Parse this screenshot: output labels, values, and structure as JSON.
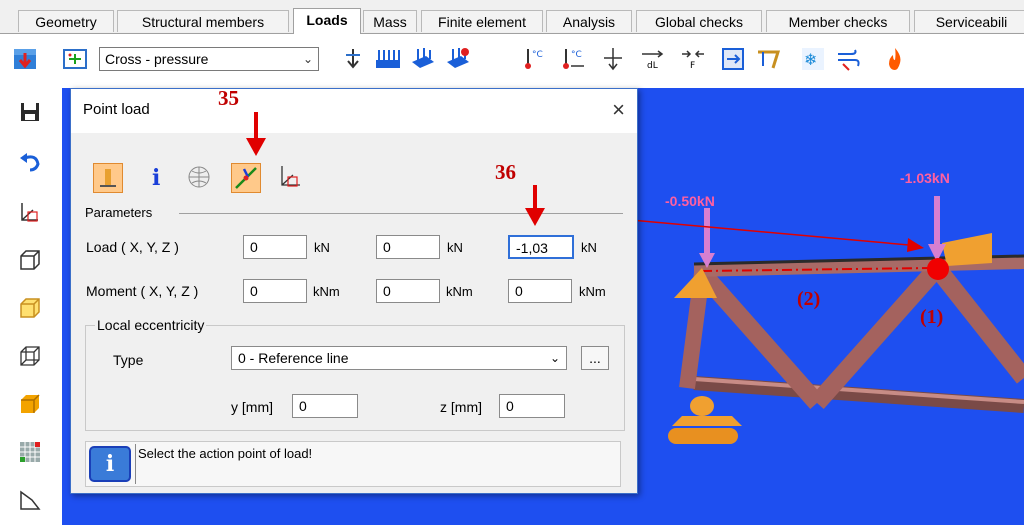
{
  "tabs": [
    {
      "label": "Geometry",
      "active": false
    },
    {
      "label": "Structural members",
      "active": false
    },
    {
      "label": "Loads",
      "active": true
    },
    {
      "label": "Mass",
      "active": false
    },
    {
      "label": "Finite element",
      "active": false
    },
    {
      "label": "Analysis",
      "active": false
    },
    {
      "label": "Global checks",
      "active": false
    },
    {
      "label": "Member checks",
      "active": false
    },
    {
      "label": "Serviceabili",
      "active": false
    }
  ],
  "toolbar": {
    "load_case": "Cross - pressure",
    "icons": [
      "load-case-icon",
      "new-load-icon",
      "dropdown-chevron-icon",
      "point-load-icon",
      "line-load-icon",
      "area-load-icon",
      "surface-load-icon",
      "temperature-icon",
      "temperature-gradient-icon",
      "load-distribution-icon",
      "displacement-load-icon",
      "force-load-icon",
      "load-transfer-icon",
      "crane-load-icon",
      "snow-load-icon",
      "wind-load-icon",
      "fire-icon"
    ]
  },
  "left_toolbar": [
    "save-icon",
    "undo-icon",
    "coordinate-system-icon",
    "view-wireframe-icon",
    "view-solid-icon",
    "view-outline-icon",
    "view-shaded-icon",
    "grid-icon",
    "polygon-icon"
  ],
  "dialog": {
    "title": "Point load",
    "close": "×",
    "section_parameters": "Parameters",
    "load_label": "Load ( X, Y, Z )",
    "load_x": "0",
    "load_y": "0",
    "load_z": "-1,03",
    "load_unit": "kN",
    "moment_label": "Moment ( X, Y, Z )",
    "moment_x": "0",
    "moment_y": "0",
    "moment_z": "0",
    "moment_unit": "kNm",
    "section_eccentricity": "Local eccentricity",
    "type_label": "Type",
    "type_value": "0 - Reference line",
    "more_button": "...",
    "y_label": "y [mm]",
    "y_value": "0",
    "z_label": "z [mm]",
    "z_value": "0",
    "info_message": "Select the action point of load!"
  },
  "annotations": {
    "step_35": "35",
    "step_36": "36",
    "node_1": "(1)",
    "member_2": "(2)"
  },
  "model": {
    "load_left": "-0.50kN",
    "load_right": "-1.03kN"
  },
  "colors": {
    "viewport_bg": "#1e4ff0",
    "annotation_red": "#e00000",
    "truss_member": "#b0706c",
    "load_arrow": "#d77fd0",
    "support": "#f0a030"
  }
}
